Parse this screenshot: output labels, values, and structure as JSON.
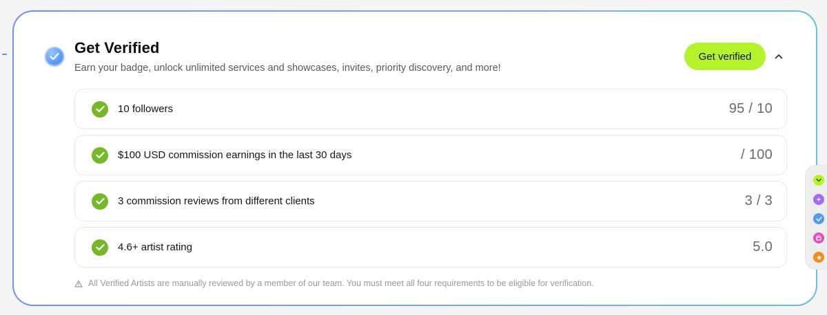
{
  "header": {
    "title": "Get Verified",
    "subtitle": "Earn your badge, unlock unlimited services and showcases, invites, priority discovery, and more!",
    "cta_label": "Get verified",
    "badge_icon": "verified-check-icon",
    "collapse_icon": "chevron-up-icon"
  },
  "requirements": [
    {
      "label": "10 followers",
      "value": "95 / 10",
      "status": "complete"
    },
    {
      "label": "$100 USD commission earnings in the last 30 days",
      "value": " / 100",
      "status": "complete"
    },
    {
      "label": "3 commission reviews from different clients",
      "value": "3 / 3",
      "status": "complete"
    },
    {
      "label": "4.6+ artist rating",
      "value": "5.0",
      "status": "complete"
    }
  ],
  "footnote": {
    "icon": "warning-triangle-icon",
    "text": "All Verified Artists are manually reviewed by a member of our team. You must meet all four requirements to be eligible for verification."
  },
  "side_dock": {
    "items": [
      {
        "icon": "lime-badge-icon",
        "color": "#b6f22c"
      },
      {
        "icon": "purple-sparkle-icon",
        "color": "#a46bf2"
      },
      {
        "icon": "blue-check-icon",
        "color": "#4f9bf0"
      },
      {
        "icon": "pink-shop-icon",
        "color": "#e44fb8"
      },
      {
        "icon": "orange-star-icon",
        "color": "#f28c1c"
      }
    ]
  },
  "colors": {
    "accent": "#b6f22c",
    "check": "#77b82a",
    "border_gradient_start": "#6f8ff0",
    "border_gradient_end": "#62c2d6"
  }
}
